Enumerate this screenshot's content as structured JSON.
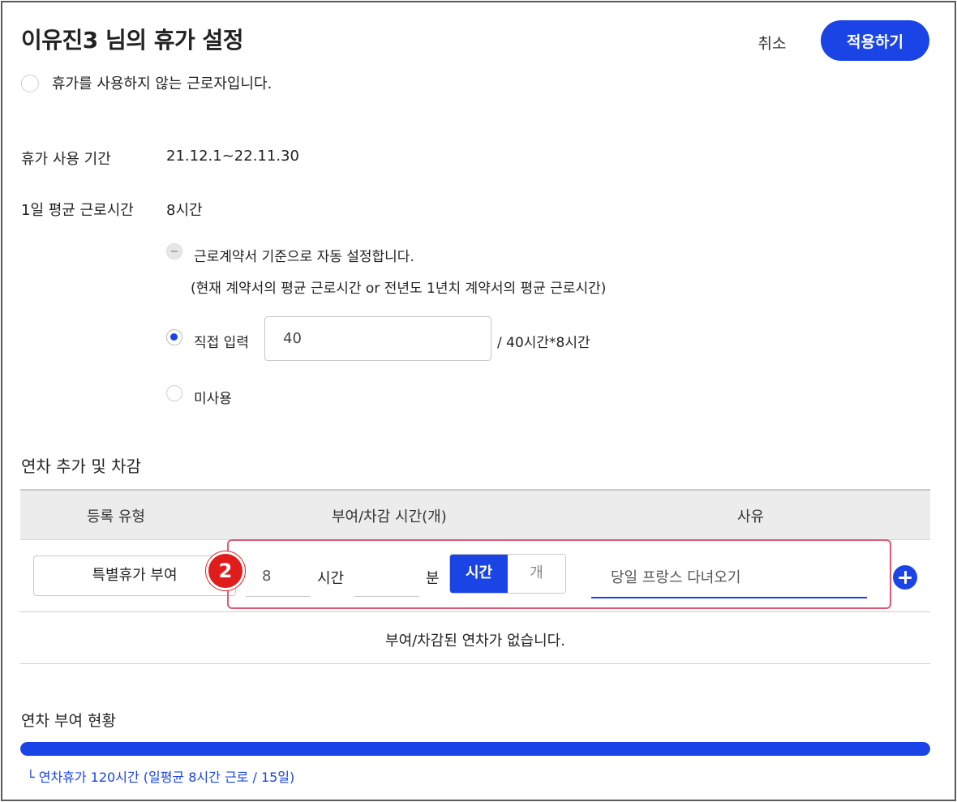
{
  "header": {
    "title": "이유진3 님의 휴가 설정",
    "cancel_label": "취소",
    "apply_label": "적용하기"
  },
  "no_leave_option": {
    "label": "휴가를 사용하지 않는 근로자입니다.",
    "checked": false
  },
  "period": {
    "label": "휴가 사용 기간",
    "value": "21.12.1~22.11.30"
  },
  "avg_hours": {
    "label": "1일 평균 근로시간",
    "value": "8시간",
    "options": {
      "auto": {
        "label": "근로계약서 기준으로 자동 설정합니다.",
        "note": "(현재 계약서의 평균 근로시간 or 전년도 1년치 계약서의 평균 근로시간)",
        "state": "disabled"
      },
      "manual": {
        "label": "직접 입력",
        "value": "40",
        "suffix": "/ 40시간*8시간",
        "state": "checked"
      },
      "unused": {
        "label": "미사용",
        "state": "unchecked"
      }
    }
  },
  "adjust_section": {
    "title": "연차 추가 및 차감",
    "columns": [
      "등록 유형",
      "부여/차감 시간(개)",
      "사유"
    ],
    "row": {
      "type": "특별휴가 부여",
      "hours_value": "8",
      "hours_unit": "시간",
      "minutes_value": "",
      "minutes_unit": "분",
      "unit_options": [
        "시간",
        "개"
      ],
      "unit_selected": "시간",
      "reason": "당일 프랑스 다녀오기"
    },
    "empty_message": "부여/차감된 연차가 없습니다.",
    "step_badge": "2"
  },
  "grant_status": {
    "title": "연차 부여 현황",
    "progress_fraction": 1.0,
    "note": "└ 연차휴가 120시간 (일평균 8시간 근로 / 15일)"
  },
  "colors": {
    "primary": "#1a44e6",
    "highlight": "#e05a73",
    "badge": "#e11c1c"
  }
}
